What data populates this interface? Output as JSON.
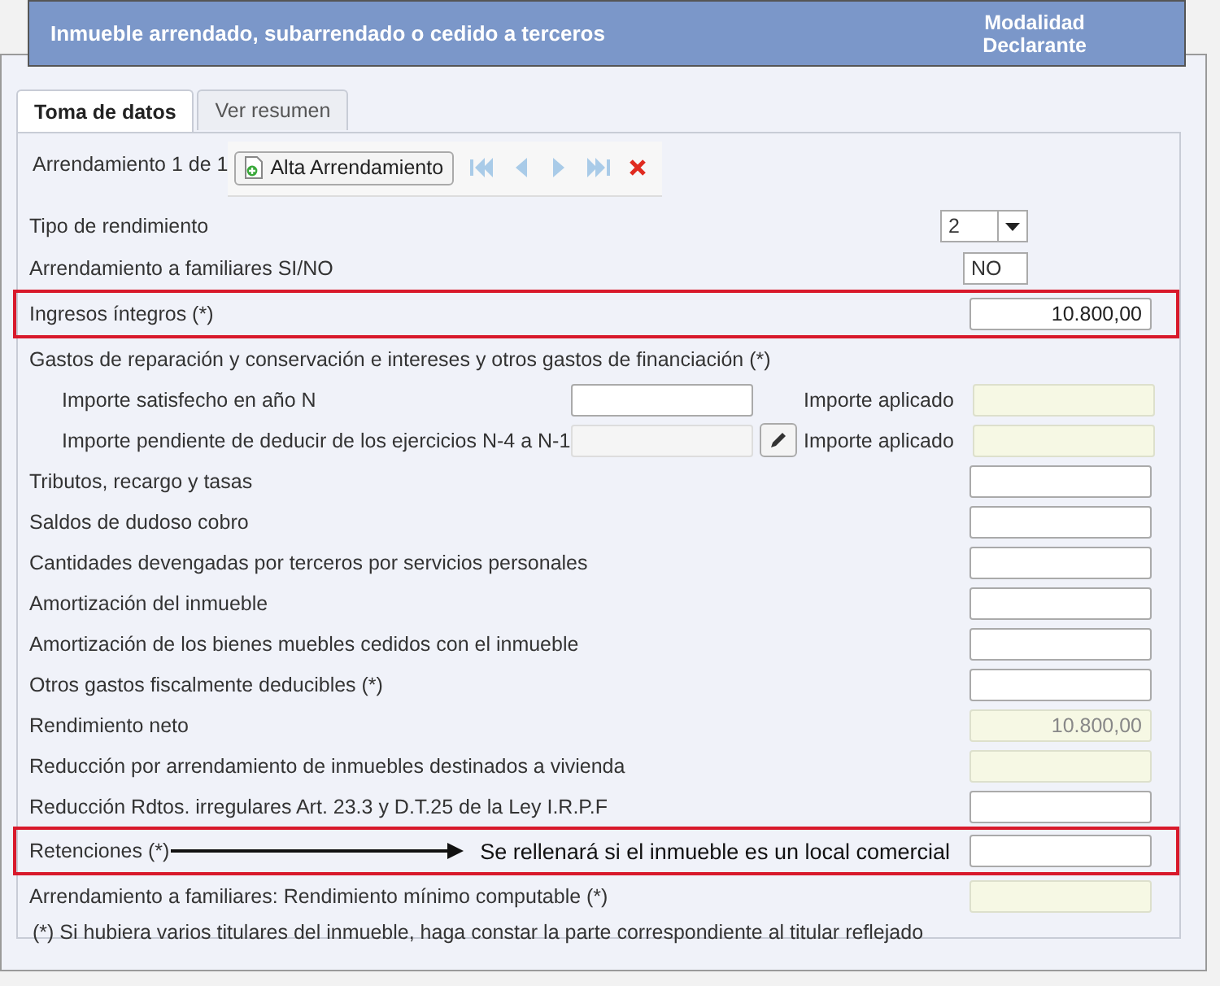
{
  "header": {
    "title": "Inmueble arrendado, subarrendado o cedido a terceros",
    "mode_lines": [
      "Modalidad",
      "Declarante"
    ]
  },
  "tabs": [
    {
      "label": "Toma de datos",
      "selected": true
    },
    {
      "label": "Ver resumen",
      "selected": false
    }
  ],
  "record": {
    "counter": "Arrendamiento 1 de 1",
    "add_button": "Alta Arrendamiento"
  },
  "rows": [
    {
      "kind": "select",
      "label": "Tipo de rendimiento",
      "value": "2",
      "highlighted": false
    },
    {
      "kind": "short",
      "label": "Arrendamiento a familiares SI/NO",
      "value": "NO",
      "highlighted": false
    },
    {
      "kind": "input",
      "label": "Ingresos íntegros (*)",
      "value": "10.800,00",
      "highlighted": true
    },
    {
      "kind": "group",
      "label": "Gastos de reparación y conservación e intereses y otros gastos de financiación (*)",
      "highlighted": false,
      "children": [
        {
          "label": "Importe satisfecho en año N",
          "disabled": false,
          "applied_label": "Importe aplicado"
        },
        {
          "label": "Importe pendiente de deducir de los ejercicios N-4 a N-1",
          "disabled": true,
          "applied_label": "Importe aplicado"
        }
      ]
    },
    {
      "kind": "input",
      "label": "Tributos, recargo y tasas",
      "highlighted": false
    },
    {
      "kind": "input",
      "label": "Saldos de dudoso cobro",
      "highlighted": false
    },
    {
      "kind": "input",
      "label": "Cantidades devengadas por terceros por servicios personales",
      "highlighted": false
    },
    {
      "kind": "input",
      "label": "Amortización del inmueble",
      "highlighted": false
    },
    {
      "kind": "input",
      "label": "Amortización de los bienes muebles cedidos con el inmueble",
      "highlighted": false
    },
    {
      "kind": "input",
      "label": "Otros gastos fiscalmente deducibles (*)",
      "highlighted": false
    },
    {
      "kind": "readonly",
      "label": "Rendimiento neto",
      "value": "10.800,00",
      "highlighted": false
    },
    {
      "kind": "readonly",
      "label": "Reducción por arrendamiento de inmuebles destinados a vivienda",
      "highlighted": false
    },
    {
      "kind": "input",
      "label": "Reducción Rdtos. irregulares Art. 23.3 y D.T.25 de la Ley I.R.P.F",
      "highlighted": false
    },
    {
      "kind": "input",
      "label": "Retenciones (*)",
      "highlighted": true,
      "note": "Se rellenará si el inmueble es un local comercial"
    },
    {
      "kind": "readonly",
      "label": "Arrendamiento a familiares: Rendimiento mínimo computable (*)",
      "highlighted": false
    }
  ],
  "footnote": "(*) Si hubiera varios titulares del inmueble, haga constar la parte correspondiente al titular reflejado"
}
